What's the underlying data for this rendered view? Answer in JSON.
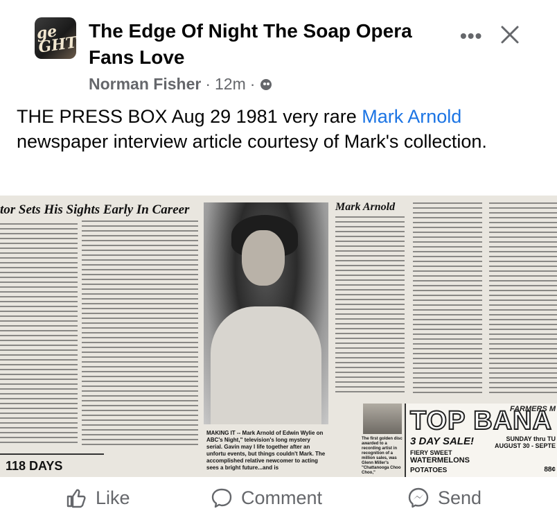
{
  "post": {
    "group_title": "The Edge Of Night The Soap Opera Fans Love",
    "author": "Norman Fisher",
    "time": "12m",
    "separator": "·",
    "text_before_link": "THE PRESS BOX Aug 29 1981 very rare ",
    "link_text": "Mark Arnold",
    "text_after_link": " newspaper interview article courtesy of Mark's collection."
  },
  "icons": {
    "more": "more-options-icon",
    "close": "close-icon",
    "audience": "group-members-icon",
    "like": "thumbs-up-icon",
    "comment": "speech-bubble-icon",
    "send": "messenger-icon"
  },
  "photo": {
    "headline": "tor Sets His Sights Early In Career",
    "byline": "Mark Arnold",
    "caption": "MAKING IT -- Mark Arnold of Edwin Wylie on ABC's Night,\" television's long mystery serial. Gavin may l life together after an unfortu events, but things couldn't Mark. The accomplished relative newcomer to acting sees a bright future...and is",
    "days": "118 DAYS",
    "ad_top": "TOP BANA",
    "ad_farmers": "FARMERS M",
    "ad_sale": "3 DAY SALE!",
    "ad_sunday": "SUNDAY thru TU AUGUST 30 - SEPTE",
    "ad_item1": "FIERY SWEET",
    "ad_item2": "WATERMELONS",
    "ad_item3": "POTATOES",
    "ad_price": "88¢",
    "milk_caption": "The first golden disc awarded to a recording artist in recognition of a million sales, was Glenn Miller's \"Chattanooga Choo Choo,\""
  },
  "actions": {
    "like": "Like",
    "comment": "Comment",
    "send": "Send"
  },
  "colors": {
    "link": "#1b74e4",
    "secondary_text": "#65676b",
    "primary_text": "#050505"
  }
}
